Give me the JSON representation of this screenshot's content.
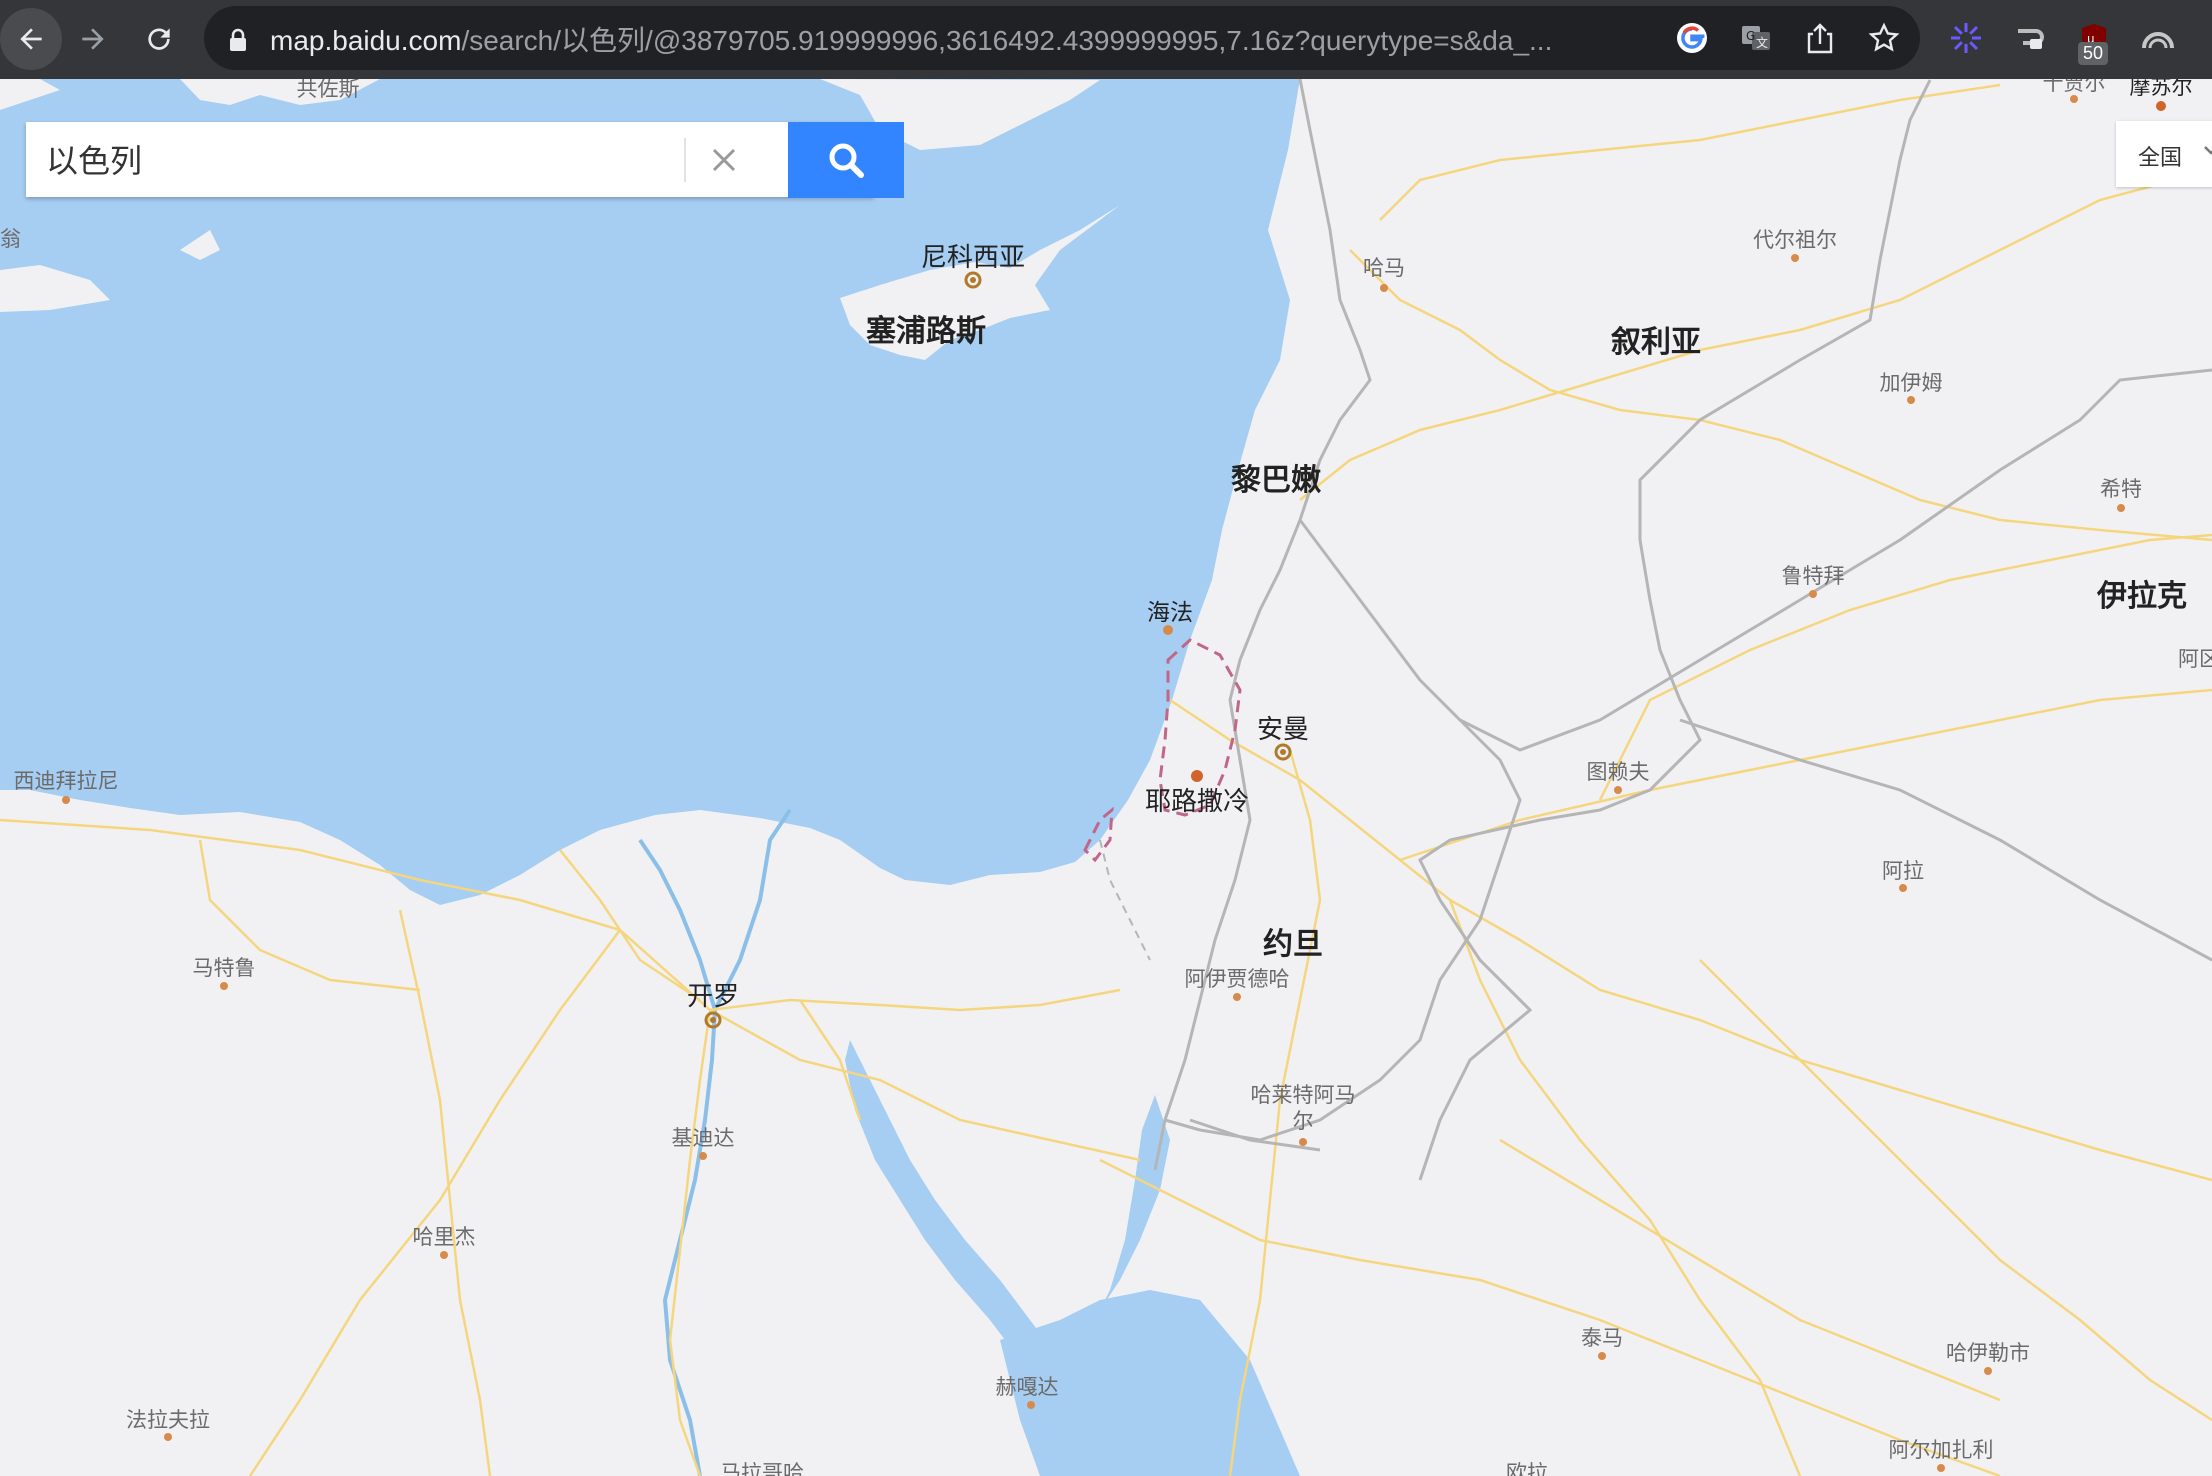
{
  "browser": {
    "url_host": "map.baidu.com",
    "url_path": "/search/以色列/@3879705.919999996,3616492.4399999995,7.16z?querytype=s&da_...",
    "extension_badge": "50"
  },
  "search": {
    "value": "以色列",
    "scope_label": "全国"
  },
  "map": {
    "countries": {
      "cyprus": "塞浦路斯",
      "lebanon": "黎巴嫩",
      "syria": "叙利亚",
      "iraq": "伊拉克",
      "jordan": "约旦"
    },
    "capitals": {
      "nicosia": "尼科西亚",
      "amman": "安曼",
      "jerusalem": "耶路撒冷",
      "cairo": "开罗"
    },
    "cities": {
      "haifa": "海法",
      "hama": "哈马",
      "deir_ez_zor": "代尔祖尔",
      "al_qaim": "加伊姆",
      "hit": "希特",
      "rutba": "鲁特拜",
      "turaif": "图赖夫",
      "arar": "阿拉",
      "aqaba": "阿伊贾德哈",
      "harat_ammar": "哈莱特阿马尔",
      "sidi_barrani": "西迪拜拉尼",
      "matruh": "马特鲁",
      "giza_south": "基迪达",
      "kharga": "哈里杰",
      "farafra": "法拉夫拉",
      "hurghada": "赫嘎达",
      "marsa_alam": "马拉哥哈",
      "tayma": "泰马",
      "hail": "哈伊勒市",
      "arqa": "阿尔加扎利",
      "ula": "欧拉",
      "mosul": "摩苏尔",
      "top_edge": "十贾尔",
      "west_edge": "翁",
      "right_edge": "阿区",
      "top_left": "共佐斯"
    }
  },
  "colors": {
    "sea": "#a6cdf2",
    "land": "#f1f1f4",
    "road": "#f5d67e",
    "border": "#b5b5b5",
    "disputed": "#c0668a",
    "search_button": "#3385ff",
    "chrome": "#35363a"
  },
  "icons": [
    "back-arrow-icon",
    "forward-arrow-icon",
    "reload-icon",
    "lock-icon",
    "google-icon",
    "translate-icon",
    "share-icon",
    "star-icon",
    "extension-icon",
    "close-icon",
    "search-icon",
    "chevron-down-icon"
  ]
}
